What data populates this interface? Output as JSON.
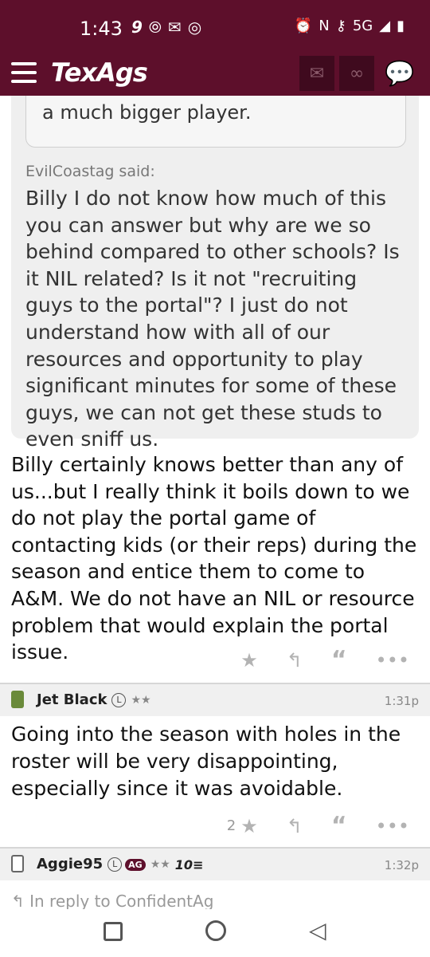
{
  "status_bar": {
    "time": "1:43",
    "left_icons": [
      "9",
      "radio-icon",
      "mail-icon",
      "instagram-icon"
    ],
    "network": "5G"
  },
  "nav": {
    "logo": "TexAgs"
  },
  "thread": {
    "inner_quote_text": "front of these transfers and become a much bigger player.",
    "quote_attribution": "EvilCoastag said:",
    "quote_text": "Billy I do not know how much of this you can answer but why are we so behind compared to other schools? Is it NIL related? Is it not \"recruiting guys to the portal\"? I just do not understand how with all of our resources and opportunity to play significant minutes for some of these guys, we can not get these studs to even sniff us.",
    "reply_text": "Billy certainly knows better than any of us...but I really think it boils down to we do not play the portal game of contacting kids (or their reps) during the season and entice them to come to A&M. We do not have an NIL or resource problem that would explain the portal issue."
  },
  "posts": [
    {
      "username": "Jet Black",
      "badge": "L",
      "stars": "★★",
      "time": "1:31p",
      "body": "Going into the season with holes in the roster will be very disappointing, especially since it was avoidable.",
      "like_count": "2"
    },
    {
      "username": "Aggie95",
      "badge": "L",
      "badge2": "AG",
      "stars": "★★",
      "rank": "10≡",
      "time": "1:32p",
      "reply_to": "In reply to ConfidentAg"
    }
  ],
  "colors": {
    "brand": "#5d0f2b",
    "quote_bg": "#efefef"
  }
}
